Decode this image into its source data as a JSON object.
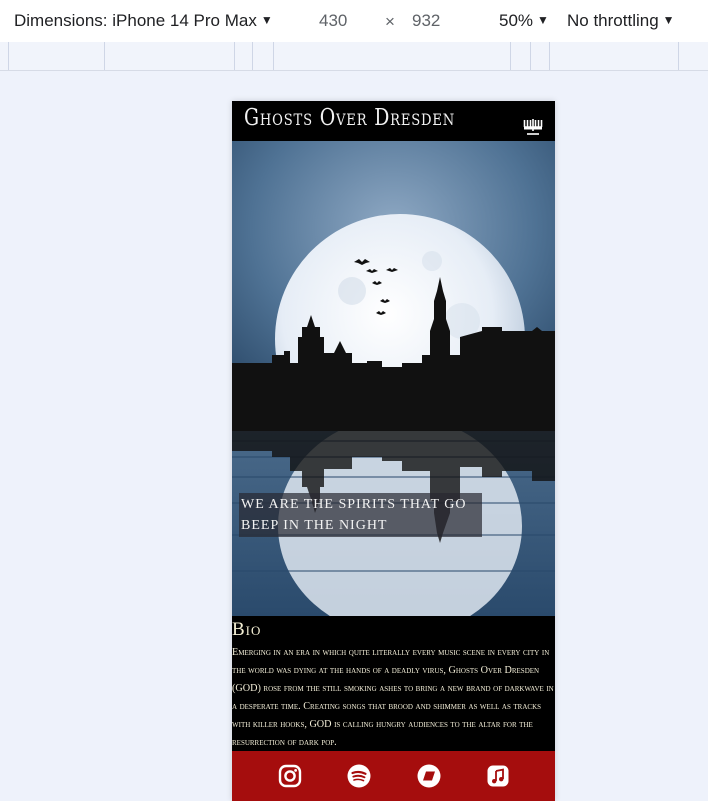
{
  "devtools": {
    "dimensions_label": "Dimensions: iPhone 14 Pro Max",
    "width": "430",
    "times": "×",
    "height": "932",
    "zoom": "50%",
    "throttling": "No throttling"
  },
  "site": {
    "title": "Ghosts Over Dresden",
    "menu_icon": "menorah-icon",
    "tagline": "We are the spirits that go beep in the night"
  },
  "bio": {
    "title": "Bio",
    "text": "Emerging in an era in which quite literally every music scene in every city in the world was dying at the hands of a deadly virus, Ghosts Over Dresden (GOD) rose from the still smoking ashes to bring a new brand of darkwave in a desperate time. Creating songs that brood and shimmer as well as tracks with killer hooks, GOD is calling hungry audiences to the altar for the resurrection of dark pop."
  },
  "footer": {
    "icons": [
      "instagram-icon",
      "spotify-icon",
      "bandcamp-icon",
      "apple-music-icon"
    ]
  },
  "colors": {
    "footer_bg": "#a50d0d",
    "navbar_bg": "#000000",
    "sky": "#4f7294"
  }
}
